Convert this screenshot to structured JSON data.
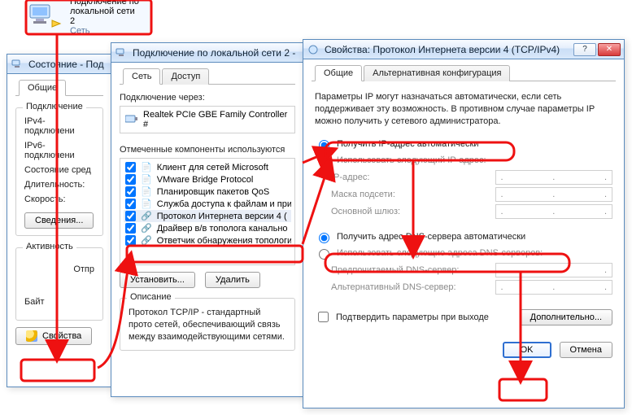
{
  "desktop_icon": {
    "line1": "Подключение по локальной сети",
    "line2": "2",
    "line3": "Сеть"
  },
  "status_window": {
    "title": "Состояние - Под",
    "tab_general": "Общие",
    "group_connection": "Подключение",
    "row_ipv4": "IPv4-подключени",
    "row_ipv6": "IPv6-подключени",
    "row_media": "Состояние сред",
    "row_duration": "Длительность:",
    "row_speed": "Скорость:",
    "btn_details": "Сведения...",
    "group_activity": "Активность",
    "row_sent": "Отпр",
    "row_bytes": "Байт",
    "btn_properties": "Свойства"
  },
  "conn_window": {
    "title": "Подключение по локальной сети 2 -",
    "tab_network": "Сеть",
    "tab_access": "Доступ",
    "label_connect_via": "Подключение через:",
    "adapter": "Realtek PCIe GBE Family Controller #",
    "label_components": "Отмеченные компоненты используются",
    "items": [
      "Клиент для сетей Microsoft",
      "VMware Bridge Protocol",
      "Планировщик пакетов QoS",
      "Служба доступа к файлам и при",
      "Протокол Интернета версии 4 (",
      "Драйвер в/в тополога канально",
      "Ответчик обнаружения топологии"
    ],
    "btn_install": "Установить...",
    "btn_remove": "Удалить",
    "group_description": "Описание",
    "description": "Протокол TCP/IP - стандартный прото сетей, обеспечивающий связь между взаимодействующими сетями."
  },
  "ipv4_window": {
    "title": "Свойства: Протокол Интернета версии 4 (TCP/IPv4)",
    "tab_general": "Общие",
    "tab_alt": "Альтернативная конфигурация",
    "intro": "Параметры IP могут назначаться автоматически, если сеть поддерживает эту возможность. В противном случае параметры IP можно получить у сетевого администратора.",
    "radio_ip_auto": "Получить IP-адрес автоматически",
    "radio_ip_manual": "Использовать следующий IP-адрес:",
    "label_ip": "IP-адрес:",
    "label_mask": "Маска подсети:",
    "label_gw": "Основной шлюз:",
    "radio_dns_auto": "Получить адрес DNS-сервера автоматически",
    "radio_dns_manual": "Использовать следующие адреса DNS-серверов:",
    "label_dns_pref": "Предпочитаемый DNS-сервер:",
    "label_dns_alt": "Альтернативный DNS-сервер:",
    "chk_validate": "Подтвердить параметры при выходе",
    "btn_advanced": "Дополнительно...",
    "btn_ok": "OK",
    "btn_cancel": "Отмена"
  }
}
